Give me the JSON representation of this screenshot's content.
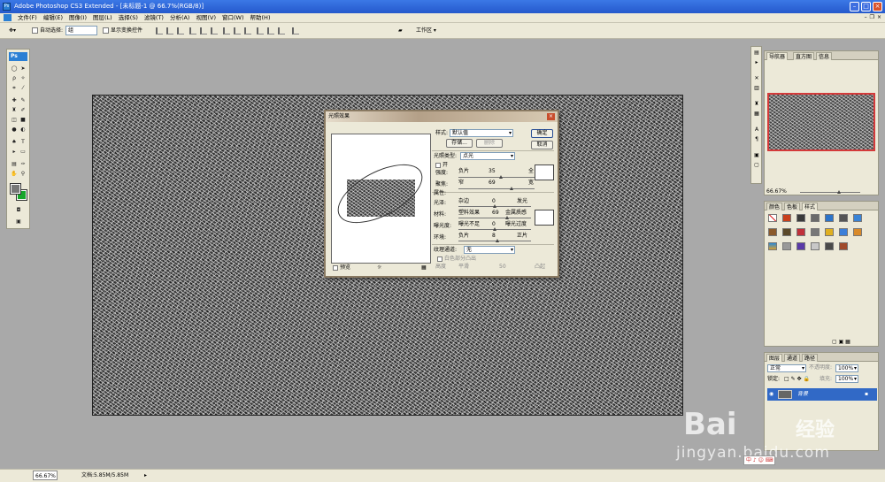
{
  "window": {
    "title": "Adobe Photoshop CS3 Extended - [未标题-1 @ 66.7%(RGB/8)]"
  },
  "menu": [
    "文件(F)",
    "编辑(E)",
    "图像(I)",
    "图层(L)",
    "选择(S)",
    "滤镜(T)",
    "分析(A)",
    "视图(V)",
    "窗口(W)",
    "帮助(H)"
  ],
  "options": {
    "auto_select_label": "自动选择:",
    "auto_select_value": "组",
    "show_transform_label": "显示变换控件",
    "workspace_label": "工作区 ▾"
  },
  "tools": {
    "logo": "Ps"
  },
  "status": {
    "zoom": "66.67%",
    "doc": "文档:5.85M/5.85M",
    "arrow": "▸"
  },
  "dialog": {
    "title": "光照效果",
    "style_label": "样式:",
    "style_value": "默认值",
    "save": "存储...",
    "delete": "删除",
    "ok": "确定",
    "cancel": "取消",
    "light_type_label": "光照类型:",
    "light_type_value": "点光",
    "on_label": "开",
    "intensity_label": "强度:",
    "intensity_left": "负片",
    "intensity_value": "35",
    "intensity_right": "全",
    "focus_label": "聚焦:",
    "focus_left": "窄",
    "focus_value": "69",
    "focus_right": "宽",
    "properties_label": "属性:",
    "gloss_label": "光泽:",
    "gloss_left": "杂边",
    "gloss_value": "0",
    "gloss_right": "发光",
    "material_label": "材料:",
    "material_left": "塑料效果",
    "material_value": "69",
    "material_right": "金属质感",
    "exposure_label": "曝光度:",
    "exposure_left": "曝光不足",
    "exposure_value": "0",
    "exposure_right": "曝光过度",
    "ambience_label": "环境:",
    "ambience_left": "负片",
    "ambience_value": "8",
    "ambience_right": "正片",
    "texture_label": "纹理通道:",
    "texture_value": "无",
    "white_high_label": "白色部分凸出",
    "height_label": "高度",
    "height_left": "平滑",
    "height_value": "50",
    "height_right": "凸起",
    "preview_label": "预览"
  },
  "navigator": {
    "tabs": [
      "导航器",
      "直方图",
      "信息"
    ],
    "zoom": "66.67%"
  },
  "styles": {
    "tabs": [
      "颜色",
      "色板",
      "样式"
    ]
  },
  "layers": {
    "tabs": [
      "图层",
      "通道",
      "路径"
    ],
    "blend": "正常",
    "opacity_label": "不透明度:",
    "opacity": "100%",
    "lock_label": "锁定:",
    "fill_label": "填充:",
    "fill": "100%",
    "layer_name": "背景"
  },
  "watermark": {
    "brand": "Bai",
    "jingyan": "经验",
    "url": "jingyan.baidu.com"
  },
  "ime": "中 ♪ ☺ ⌨"
}
